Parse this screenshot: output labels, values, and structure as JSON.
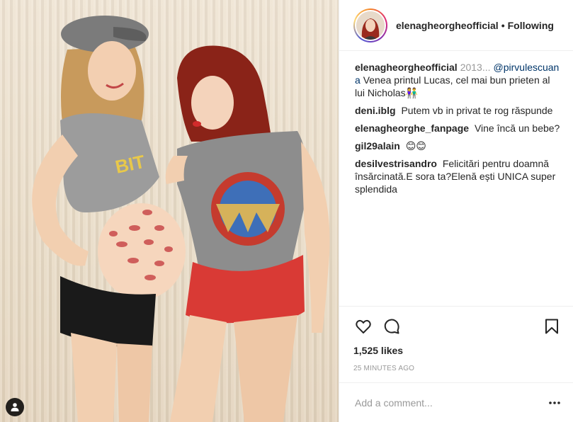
{
  "post": {
    "author": "elenagheorgheofficial",
    "separator": "•",
    "follow_state": "Following",
    "caption": {
      "user": "elenagheorgheofficial",
      "truncated_lead": "2013...",
      "mention": "@pirvulescuana",
      "text": "Venea printul Lucas, cel mai bun prieten al lui Nicholas",
      "emoji": "👫"
    },
    "comments": [
      {
        "user": "deni.iblg",
        "text": "Putem vb in privat te rog răspunde"
      },
      {
        "user": "elenagheorghe_fanpage",
        "text": "Vine încă un bebe?"
      },
      {
        "user": "gil29alain",
        "text": "😊😊"
      },
      {
        "user": "desilvestrisandro",
        "text": "Felicitări pentru doamnă însărcinată.E sora ta?Elenă ești UNICA super splendida"
      }
    ],
    "likes": "1,525 likes",
    "timestamp": "25 MINUTES AGO",
    "add_comment_placeholder": "Add a comment...",
    "icons": {
      "like": "heart-icon",
      "comment": "comment-bubble-icon",
      "save": "bookmark-icon",
      "options": "more-options-icon",
      "user_tags": "user-tag-icon"
    }
  }
}
